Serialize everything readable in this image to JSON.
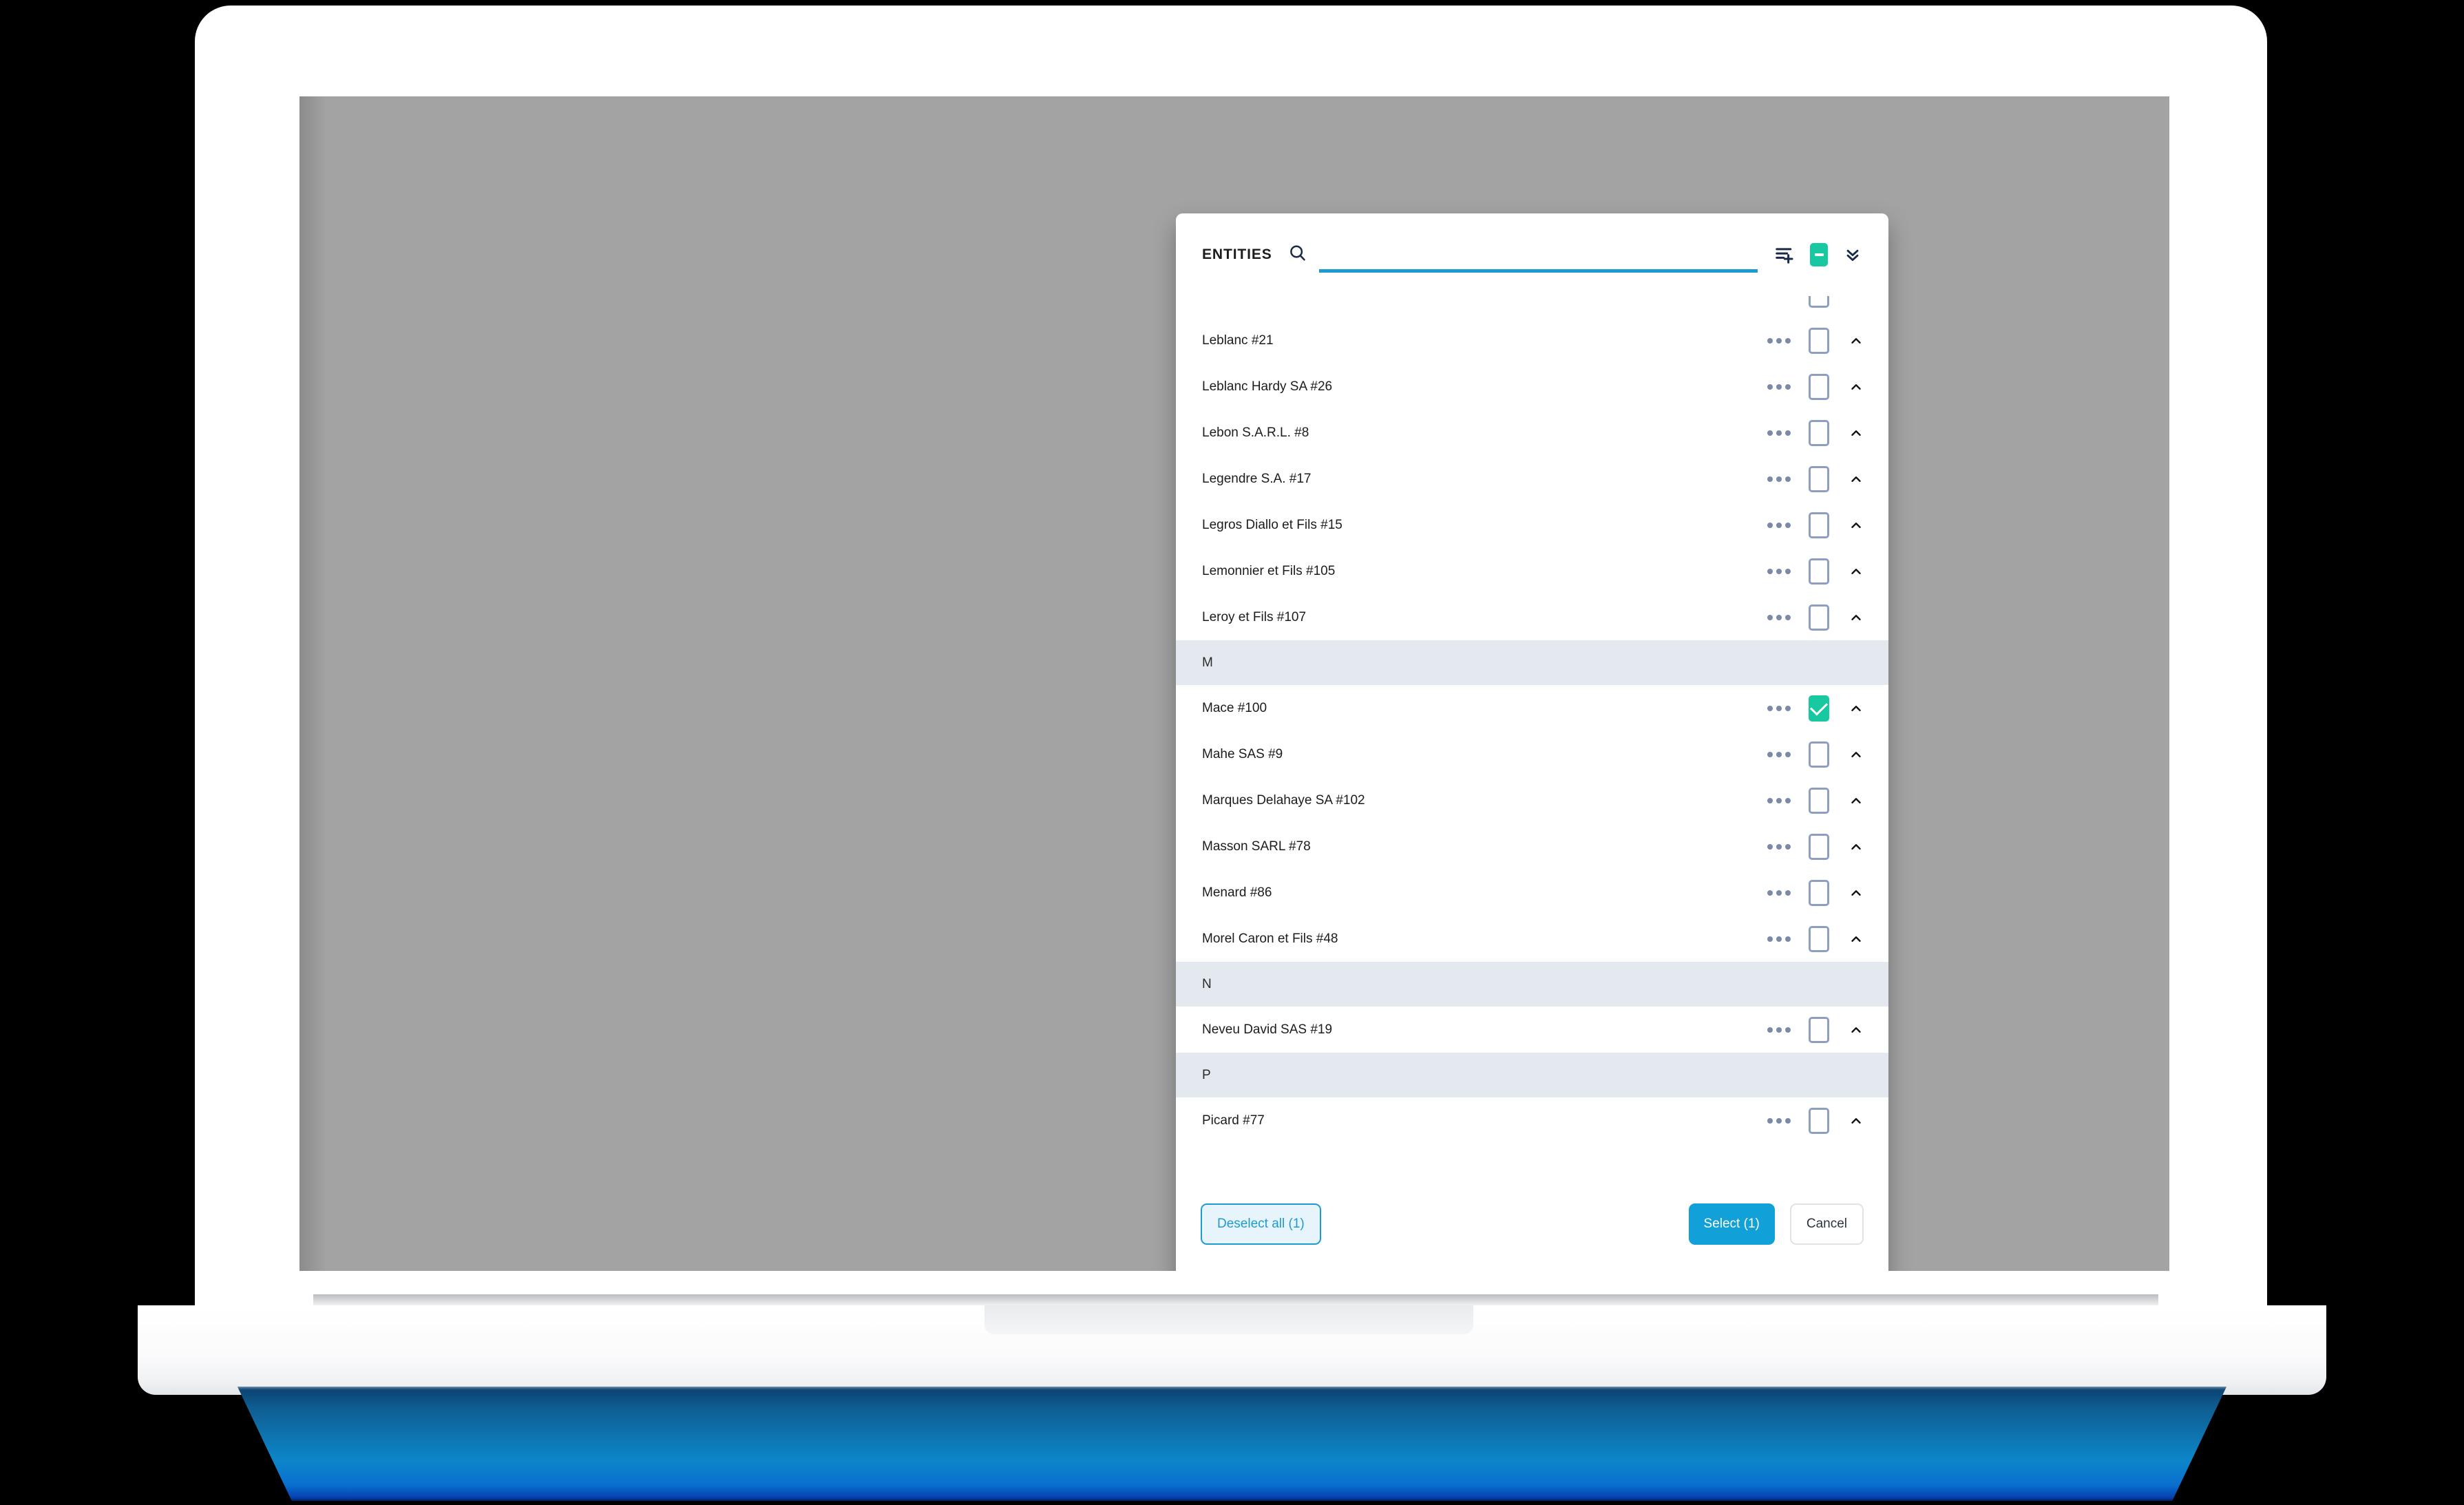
{
  "dialog": {
    "header": {
      "title": "ENTITIES",
      "search": {
        "value": "",
        "placeholder": "",
        "icon": "search-icon",
        "underline_color": "#1d9bd1"
      },
      "actions": [
        {
          "name": "add-to-list-icon",
          "label": "Add to list"
        },
        {
          "name": "indeterminate-checkbox-icon",
          "label": "Select all",
          "state": "indeterminate",
          "color": "#17c8a0"
        },
        {
          "name": "collapse-all-icon",
          "label": "Collapse all"
        }
      ]
    },
    "list": {
      "groups": [
        {
          "letter": "",
          "show_header": false,
          "items": [
            {
              "name": "",
              "checked": false,
              "partial": true
            },
            {
              "name": "Leblanc #21",
              "checked": false
            },
            {
              "name": "Leblanc Hardy SA #26",
              "checked": false
            },
            {
              "name": "Lebon S.A.R.L. #8",
              "checked": false
            },
            {
              "name": "Legendre S.A. #17",
              "checked": false
            },
            {
              "name": "Legros Diallo et Fils #15",
              "checked": false
            },
            {
              "name": "Lemonnier et Fils #105",
              "checked": false
            },
            {
              "name": "Leroy et Fils #107",
              "checked": false
            }
          ]
        },
        {
          "letter": "M",
          "show_header": true,
          "items": [
            {
              "name": "Mace #100",
              "checked": true
            },
            {
              "name": "Mahe SAS #9",
              "checked": false
            },
            {
              "name": "Marques Delahaye SA #102",
              "checked": false
            },
            {
              "name": "Masson SARL #78",
              "checked": false
            },
            {
              "name": "Menard #86",
              "checked": false
            },
            {
              "name": "Morel Caron et Fils #48",
              "checked": false
            }
          ]
        },
        {
          "letter": "N",
          "show_header": true,
          "items": [
            {
              "name": "Neveu David SAS #19",
              "checked": false
            }
          ]
        },
        {
          "letter": "P",
          "show_header": true,
          "items": [
            {
              "name": "Picard #77",
              "checked": false
            }
          ]
        }
      ],
      "row_icons": {
        "menu": "more-options-icon",
        "checkbox": "row-checkbox",
        "collapse": "chevron-up-icon"
      }
    },
    "footer": {
      "deselect_all_label": "Deselect all (1)",
      "select_label": "Select (1)",
      "cancel_label": "Cancel",
      "selected_count": 1
    }
  },
  "theme": {
    "accent_blue": "#1d9bd1",
    "primary_button": "#12a0d9",
    "checked_green": "#17c8a0",
    "section_header_bg": "#e3e9ee",
    "icon_navy": "#1a2b4a",
    "dots_slate": "#7b8aa6",
    "backdrop_gray": "#a3a3a3"
  }
}
